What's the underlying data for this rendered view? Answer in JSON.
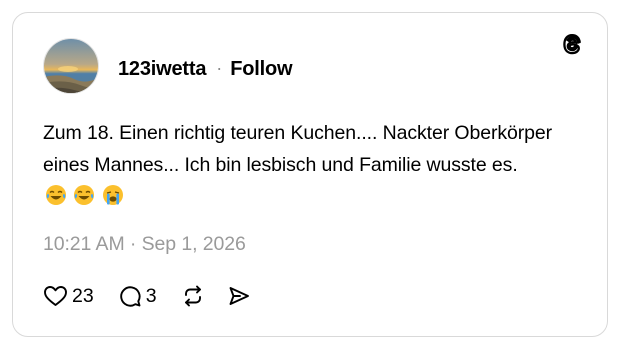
{
  "post": {
    "username": "123iwetta",
    "separator": "·",
    "follow_label": "Follow",
    "text": "Zum 18. Einen richtig teuren Kuchen.... Nackter Oberkörper eines Mannes... Ich bin lesbisch und Familie wusste es.",
    "emojis": [
      "joy",
      "joy",
      "sob"
    ],
    "timestamp": "10:21 AM · Sep 1, 2026",
    "like_count": "23",
    "reply_count": "3"
  },
  "icons": {
    "brand": "threads-logo-icon",
    "like": "heart-icon",
    "reply": "comment-icon",
    "repost": "repost-icon",
    "share": "send-icon"
  },
  "colors": {
    "border": "#d9d9d9",
    "text": "#000000",
    "muted": "#9a9a9a",
    "emoji_face": "#fbc02d"
  }
}
